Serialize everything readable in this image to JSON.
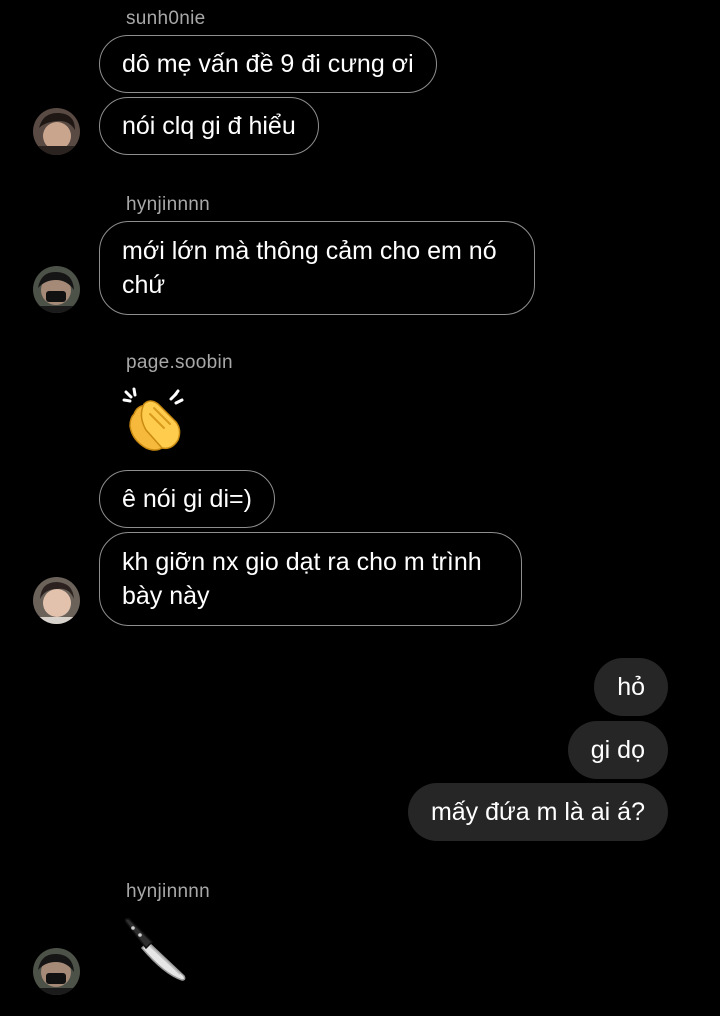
{
  "thread": {
    "groups": [
      {
        "username": "sunh0nie",
        "messages": [
          "dô mẹ vấn đề 9 đi cưng ơi",
          "nói clq gi đ hiểu"
        ]
      },
      {
        "username": "hynjinnnn",
        "messages": [
          "mới lớn mà thông cảm cho em nó chứ"
        ]
      },
      {
        "username": "page.soobin",
        "emoji": "clapping-hands",
        "messages": [
          "ê nói gi di=)",
          "kh giỡn nx gio dạt ra cho m trình bày này"
        ]
      },
      {
        "username": "hynjinnnn",
        "emoji": "kitchen-knife"
      }
    ],
    "outgoing": [
      "hỏ",
      "gi dọ",
      "mấy đứa m là ai á?"
    ]
  },
  "colors": {
    "background": "#000000",
    "incoming_border": "#8e8e8e",
    "outgoing_bubble": "#262626",
    "username": "#a8a8a8",
    "text": "#ffffff"
  }
}
